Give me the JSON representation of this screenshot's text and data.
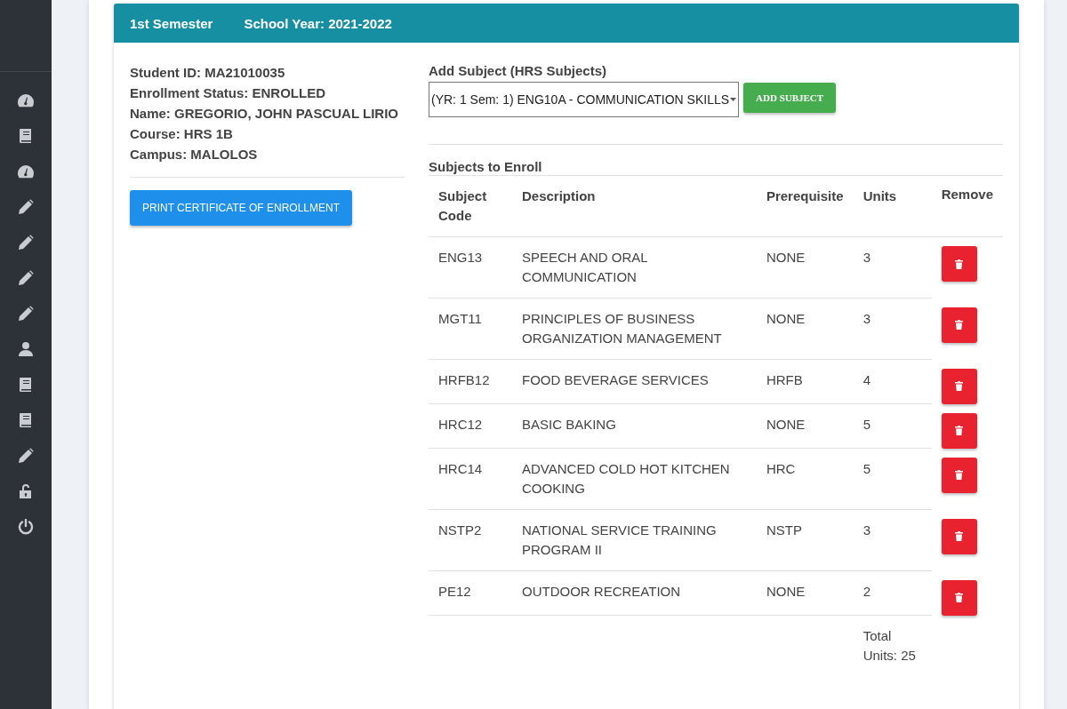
{
  "sidebar": {
    "items": [
      {
        "kind": "gauge"
      },
      {
        "kind": "book"
      },
      {
        "kind": "gauge"
      },
      {
        "kind": "pencil"
      },
      {
        "kind": "pencil"
      },
      {
        "kind": "pencil"
      },
      {
        "kind": "pencil"
      },
      {
        "kind": "user"
      },
      {
        "kind": "book"
      },
      {
        "kind": "book"
      },
      {
        "kind": "pencil"
      },
      {
        "kind": "unlock"
      },
      {
        "kind": "power"
      }
    ]
  },
  "header": {
    "semester": "1st Semester",
    "school_year": "School Year: 2021-2022"
  },
  "student": [
    "Student ID: MA21010035",
    "Enrollment Status: ENROLLED",
    "Name: GREGORIO, JOHN PASCUAL LIRIO",
    "Course: HRS 1B",
    "Campus: MALOLOS"
  ],
  "print_button": "PRINT CERTIFICATE OF ENROLLMENT",
  "add_subject": {
    "label": "Add Subject (HRS Subjects)",
    "value": "(YR: 1 Sem: 1) ENG10A - COMMUNICATION SKILLS",
    "button": "ADD SUBJECT"
  },
  "table": {
    "title": "Subjects to Enroll",
    "columns": [
      "Subject Code",
      "Description",
      "Prerequisite",
      "Units",
      "Remove"
    ],
    "rows": [
      {
        "code": "ENG13",
        "description": "SPEECH AND ORAL COMMUNICATION",
        "prerequisite": "NONE",
        "units": "3"
      },
      {
        "code": "MGT11",
        "description": "PRINCIPLES OF BUSINESS ORGANIZATION MANAGEMENT",
        "prerequisite": "NONE",
        "units": "3"
      },
      {
        "code": "HRFB12",
        "description": "FOOD BEVERAGE SERVICES",
        "prerequisite": "HRFB",
        "units": "4"
      },
      {
        "code": "HRC12",
        "description": "BASIC BAKING",
        "prerequisite": "NONE",
        "units": "5"
      },
      {
        "code": "HRC14",
        "description": "ADVANCED COLD HOT KITCHEN COOKING",
        "prerequisite": "HRC",
        "units": "5"
      },
      {
        "code": "NSTP2",
        "description": "NATIONAL SERVICE TRAINING PROGRAM II",
        "prerequisite": "NSTP",
        "units": "3"
      },
      {
        "code": "PE12",
        "description": "OUTDOOR RECREATION",
        "prerequisite": "NONE",
        "units": "2"
      }
    ],
    "total": "Total Units: 25"
  }
}
